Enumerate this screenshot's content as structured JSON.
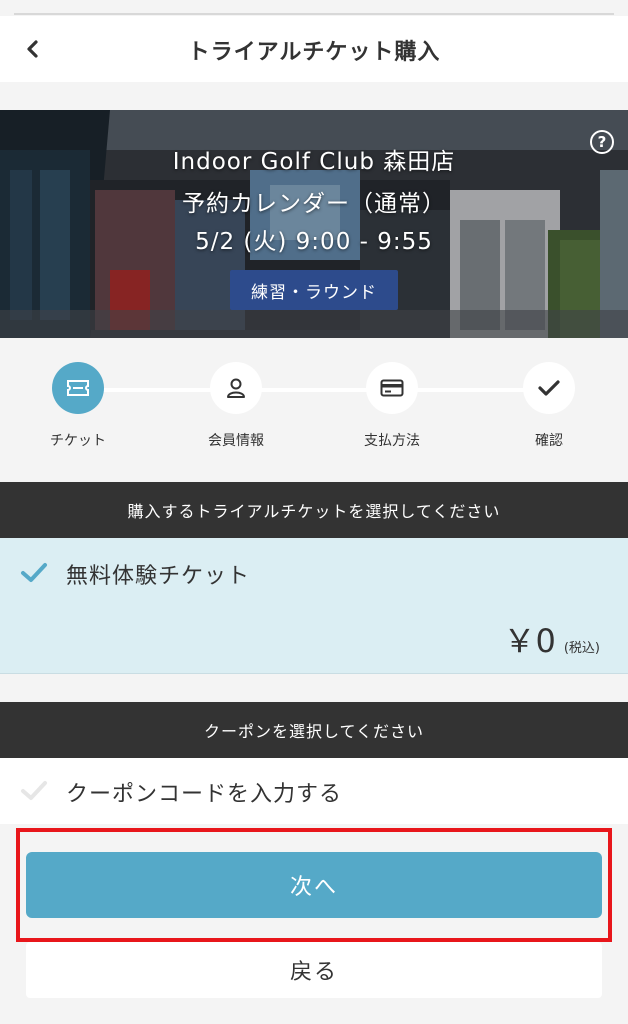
{
  "header": {
    "title": "トライアルチケット購入"
  },
  "hero": {
    "club_name": "Indoor Golf Club 森田店",
    "calendar_name": "予約カレンダー（通常）",
    "datetime": "5/2 (火)  9:00 - 9:55",
    "badge": "練習・ラウンド",
    "help": "?"
  },
  "steps": [
    {
      "label": "チケット",
      "icon": "ticket-icon",
      "active": true
    },
    {
      "label": "会員情報",
      "icon": "user-icon",
      "active": false
    },
    {
      "label": "支払方法",
      "icon": "credit-card-icon",
      "active": false
    },
    {
      "label": "確認",
      "icon": "check-icon",
      "active": false
    }
  ],
  "ticket_section": {
    "heading": "購入するトライアルチケットを選択してください",
    "item": {
      "name": "無料体験チケット",
      "price": "￥0",
      "tax_note": "(税込)",
      "selected": true
    }
  },
  "coupon_section": {
    "heading": "クーポンを選択してください",
    "item_label": "クーポンコードを入力する"
  },
  "actions": {
    "next": "次へ",
    "back": "戻る"
  },
  "colors": {
    "accent": "#55a9c8",
    "dark_bar": "#333333",
    "selected_bg": "#dbeef3",
    "badge": "#2d4b8c",
    "highlight": "#e8161b"
  }
}
